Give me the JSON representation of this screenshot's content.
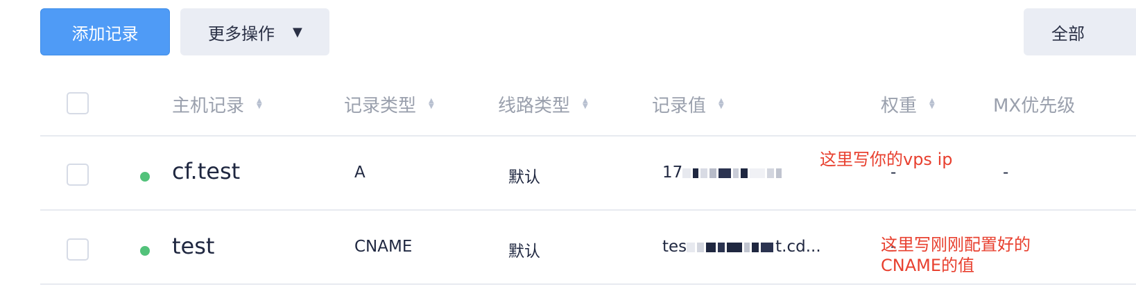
{
  "toolbar": {
    "add_record": "添加记录",
    "more_actions": "更多操作",
    "more_caret": "▼",
    "all_label": "全部"
  },
  "table": {
    "headers": {
      "host": "主机记录",
      "type": "记录类型",
      "line": "线路类型",
      "value": "记录值",
      "weight": "权重",
      "mx": "MX优先级"
    },
    "rows": [
      {
        "host": "cf.test",
        "type": "A",
        "line": "默认",
        "value_prefix": "17",
        "value_suffix": "",
        "weight": "-",
        "mx": "-",
        "status_color": "#52c27a"
      },
      {
        "host": "test",
        "type": "CNAME",
        "line": "默认",
        "value_prefix": "tes",
        "value_suffix": "t.cd...",
        "weight": "-",
        "mx": "",
        "status_color": "#52c27a"
      }
    ]
  },
  "annotations": {
    "vps_ip": "这里写你的vps ip",
    "cname_line1": "这里写刚刚配置好的",
    "cname_line2": "CNAME的值"
  }
}
